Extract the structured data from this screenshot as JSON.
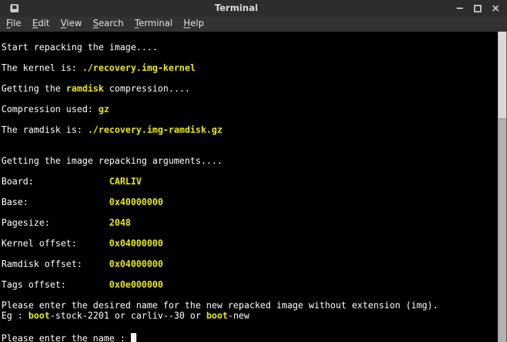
{
  "window": {
    "title": "Terminal"
  },
  "titlebar": {
    "icons": [
      {
        "name": "terminal-app-icon"
      },
      {
        "name": "minimize-icon",
        "glyph": "–"
      },
      {
        "name": "maximize-icon",
        "glyph": "□"
      },
      {
        "name": "close-icon",
        "glyph": "✕"
      }
    ]
  },
  "menubar": {
    "items": [
      {
        "label": "File"
      },
      {
        "label": "Edit"
      },
      {
        "label": "View"
      },
      {
        "label": "Search"
      },
      {
        "label": "Terminal"
      },
      {
        "label": "Help"
      }
    ]
  },
  "terminal": {
    "colors": {
      "background": "#000000",
      "foreground": "#ffffff",
      "accent_yellow": "#e8e808"
    },
    "cursor_style": "block",
    "lines": [
      {
        "segments": []
      },
      {
        "segments": [
          {
            "text": "Start repacking the image....",
            "color": "fg"
          }
        ]
      },
      {
        "segments": []
      },
      {
        "segments": [
          {
            "text": "The kernel is: ",
            "color": "fg"
          },
          {
            "text": "./recovery.img-kernel",
            "color": "yellow"
          }
        ]
      },
      {
        "segments": []
      },
      {
        "segments": [
          {
            "text": "Getting the ",
            "color": "fg"
          },
          {
            "text": "ramdisk",
            "color": "yellow"
          },
          {
            "text": " compression....",
            "color": "fg"
          }
        ]
      },
      {
        "segments": []
      },
      {
        "segments": [
          {
            "text": "Compression used: ",
            "color": "fg"
          },
          {
            "text": "gz",
            "color": "yellow"
          }
        ]
      },
      {
        "segments": []
      },
      {
        "segments": [
          {
            "text": "The ramdisk is: ",
            "color": "fg"
          },
          {
            "text": "./recovery.img-ramdisk.gz",
            "color": "yellow"
          }
        ]
      },
      {
        "segments": []
      },
      {
        "segments": []
      },
      {
        "segments": [
          {
            "text": "Getting the image repacking arguments....",
            "color": "fg"
          }
        ]
      },
      {
        "segments": []
      },
      {
        "segments": [
          {
            "text": "Board:              ",
            "color": "fg"
          },
          {
            "text": "CARLIV",
            "color": "yellow"
          }
        ]
      },
      {
        "segments": []
      },
      {
        "segments": [
          {
            "text": "Base:               ",
            "color": "fg"
          },
          {
            "text": "0x40000000",
            "color": "yellow"
          }
        ]
      },
      {
        "segments": []
      },
      {
        "segments": [
          {
            "text": "Pagesize:           ",
            "color": "fg"
          },
          {
            "text": "2048",
            "color": "yellow"
          }
        ]
      },
      {
        "segments": []
      },
      {
        "segments": [
          {
            "text": "Kernel offset:      ",
            "color": "fg"
          },
          {
            "text": "0x04000000",
            "color": "yellow"
          }
        ]
      },
      {
        "segments": []
      },
      {
        "segments": [
          {
            "text": "Ramdisk offset:     ",
            "color": "fg"
          },
          {
            "text": "0x04000000",
            "color": "yellow"
          }
        ]
      },
      {
        "segments": []
      },
      {
        "segments": [
          {
            "text": "Tags offset:        ",
            "color": "fg"
          },
          {
            "text": "0x0e000000",
            "color": "yellow"
          }
        ]
      },
      {
        "segments": []
      },
      {
        "segments": [
          {
            "text": "Please enter the desired name for the new repacked image without extension (img).",
            "color": "fg"
          }
        ]
      },
      {
        "segments": [
          {
            "text": "Eg : ",
            "color": "fg"
          },
          {
            "text": "boot",
            "color": "yellow"
          },
          {
            "text": "-stock-2201 or carliv--30 or ",
            "color": "fg"
          },
          {
            "text": "boot",
            "color": "yellow"
          },
          {
            "text": "-new",
            "color": "fg"
          }
        ]
      },
      {
        "segments": []
      },
      {
        "segments": [
          {
            "text": "Please enter the name : ",
            "color": "fg"
          }
        ],
        "cursor": true
      }
    ]
  }
}
